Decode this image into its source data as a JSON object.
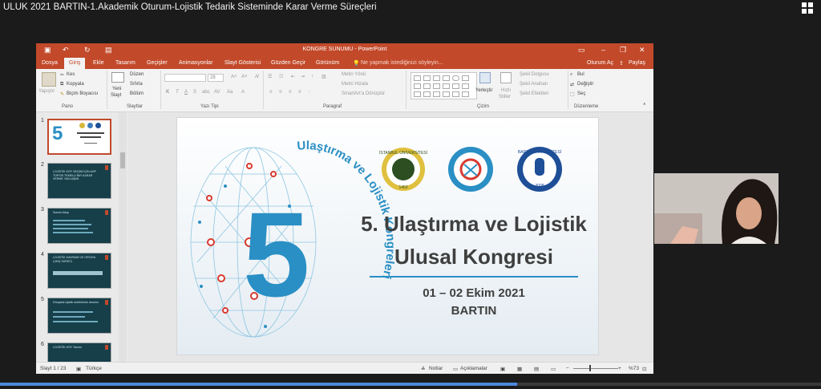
{
  "meeting": {
    "title": "ULUK 2021 BARTIN-1.Akademik Oturum-Lojistik Tedarik Sisteminde Karar Verme Süreçleri",
    "progress_fraction": 0.63
  },
  "powerpoint": {
    "window_title": "KONGRE SUNUMU - PowerPoint",
    "menu": [
      "Dosya",
      "Giriş",
      "Ekle",
      "Tasarım",
      "Geçişler",
      "Animasyonlar",
      "Slayt Gösterisi",
      "Gözden Geçir",
      "Görünüm"
    ],
    "active_menu": "Giriş",
    "tell_me": "Ne yapmak istediğinizi söyleyin...",
    "sign_in": "Oturum Aç",
    "share": "Paylaş",
    "ribbon": {
      "paste": "Yapıştır",
      "cut": "Kes",
      "copy": "Kopyala",
      "format_painter": "Biçim Boyacısı",
      "new_slide": "Yeni",
      "new_slide2": "Slayt",
      "layout": "Düzen",
      "reset": "Sıfırla",
      "section": "Bölüm",
      "font_size": "28",
      "text_direction": "Metin Yönü",
      "align_text": "Metni Hizala",
      "smartart": "SmartArt'a Dönüştür",
      "arrange": "Yerleştir",
      "quick_styles": "Hızlı",
      "quick_styles2": "Stiller",
      "shape_fill": "Şekil Dolgusu",
      "shape_outline": "Şekil Anahatı",
      "shape_effects": "Şekil Efektleri",
      "find": "Bul",
      "replace": "Değiştir",
      "select": "Seç",
      "groups": [
        "Pano",
        "Slaytlar",
        "Yazı Tipi",
        "Paragraf",
        "Çizim",
        "Düzenleme"
      ]
    },
    "thumbnails": [
      {
        "num": "1",
        "text": ""
      },
      {
        "num": "2",
        "text": "LOJİSTİK KÖY SEÇİMİ İÇİN AHP TOPSIS TEMELLİ BİR KARAR VERME YAKLAŞIMI"
      },
      {
        "num": "3",
        "text": "Sunum Akışı"
      },
      {
        "num": "4",
        "text": "LOJİSTİK KAVRAMI VE ORTAYA ÇIKIŞ SÜRECİ"
      },
      {
        "num": "5",
        "text": "Dünyada lojistik sektörünün durumu"
      },
      {
        "num": "6",
        "text": "LOJİSTİK KÖY Tanımı"
      }
    ],
    "slide": {
      "ring_text": "Ulaştırma ve Lojistik Kongreleri",
      "big_number": "5",
      "title_line1": "5. Ulaştırma ve Lojistik",
      "title_line2": "Ulusal Kongresi",
      "date": "01 – 02 Ekim 2021",
      "city": "BARTIN",
      "logo1_text": "İSTANBUL ÜNİVERSİTESİ",
      "logo1_year": "1453",
      "logo3_text": "BARTIN ÜNİVERSİTESİ",
      "logo3_year": "2008"
    },
    "status": {
      "slide_counter": "Slayt 1 / 23",
      "language": "Türkçe",
      "notes": "Notlar",
      "comments": "Açıklamalar",
      "zoom": "%73"
    }
  },
  "colors": {
    "ppt_accent": "#c2492a",
    "slide_blue": "#2a8fc4",
    "slide_red": "#d93a2f",
    "title_gray": "#3f3f3f"
  }
}
